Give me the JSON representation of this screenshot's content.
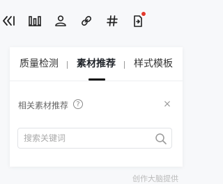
{
  "toolbar": {
    "icons": [
      {
        "name": "collapse-icon"
      },
      {
        "name": "bar-chart-icon"
      },
      {
        "name": "user-icon"
      },
      {
        "name": "link-icon"
      },
      {
        "name": "hashtag-icon"
      },
      {
        "name": "export-icon",
        "has_notification": true
      }
    ],
    "notification_color": "#e23a2e"
  },
  "panel": {
    "tabs": [
      {
        "label": "质量检测",
        "active": false
      },
      {
        "label": "素材推荐",
        "active": true
      },
      {
        "label": "样式模板",
        "active": false
      }
    ],
    "section": {
      "title": "相关素材推荐",
      "help_icon": "?",
      "close_icon": "×"
    },
    "search": {
      "placeholder": "搜索关键词",
      "value": ""
    }
  },
  "footer": {
    "text": "创作大脑提供"
  }
}
